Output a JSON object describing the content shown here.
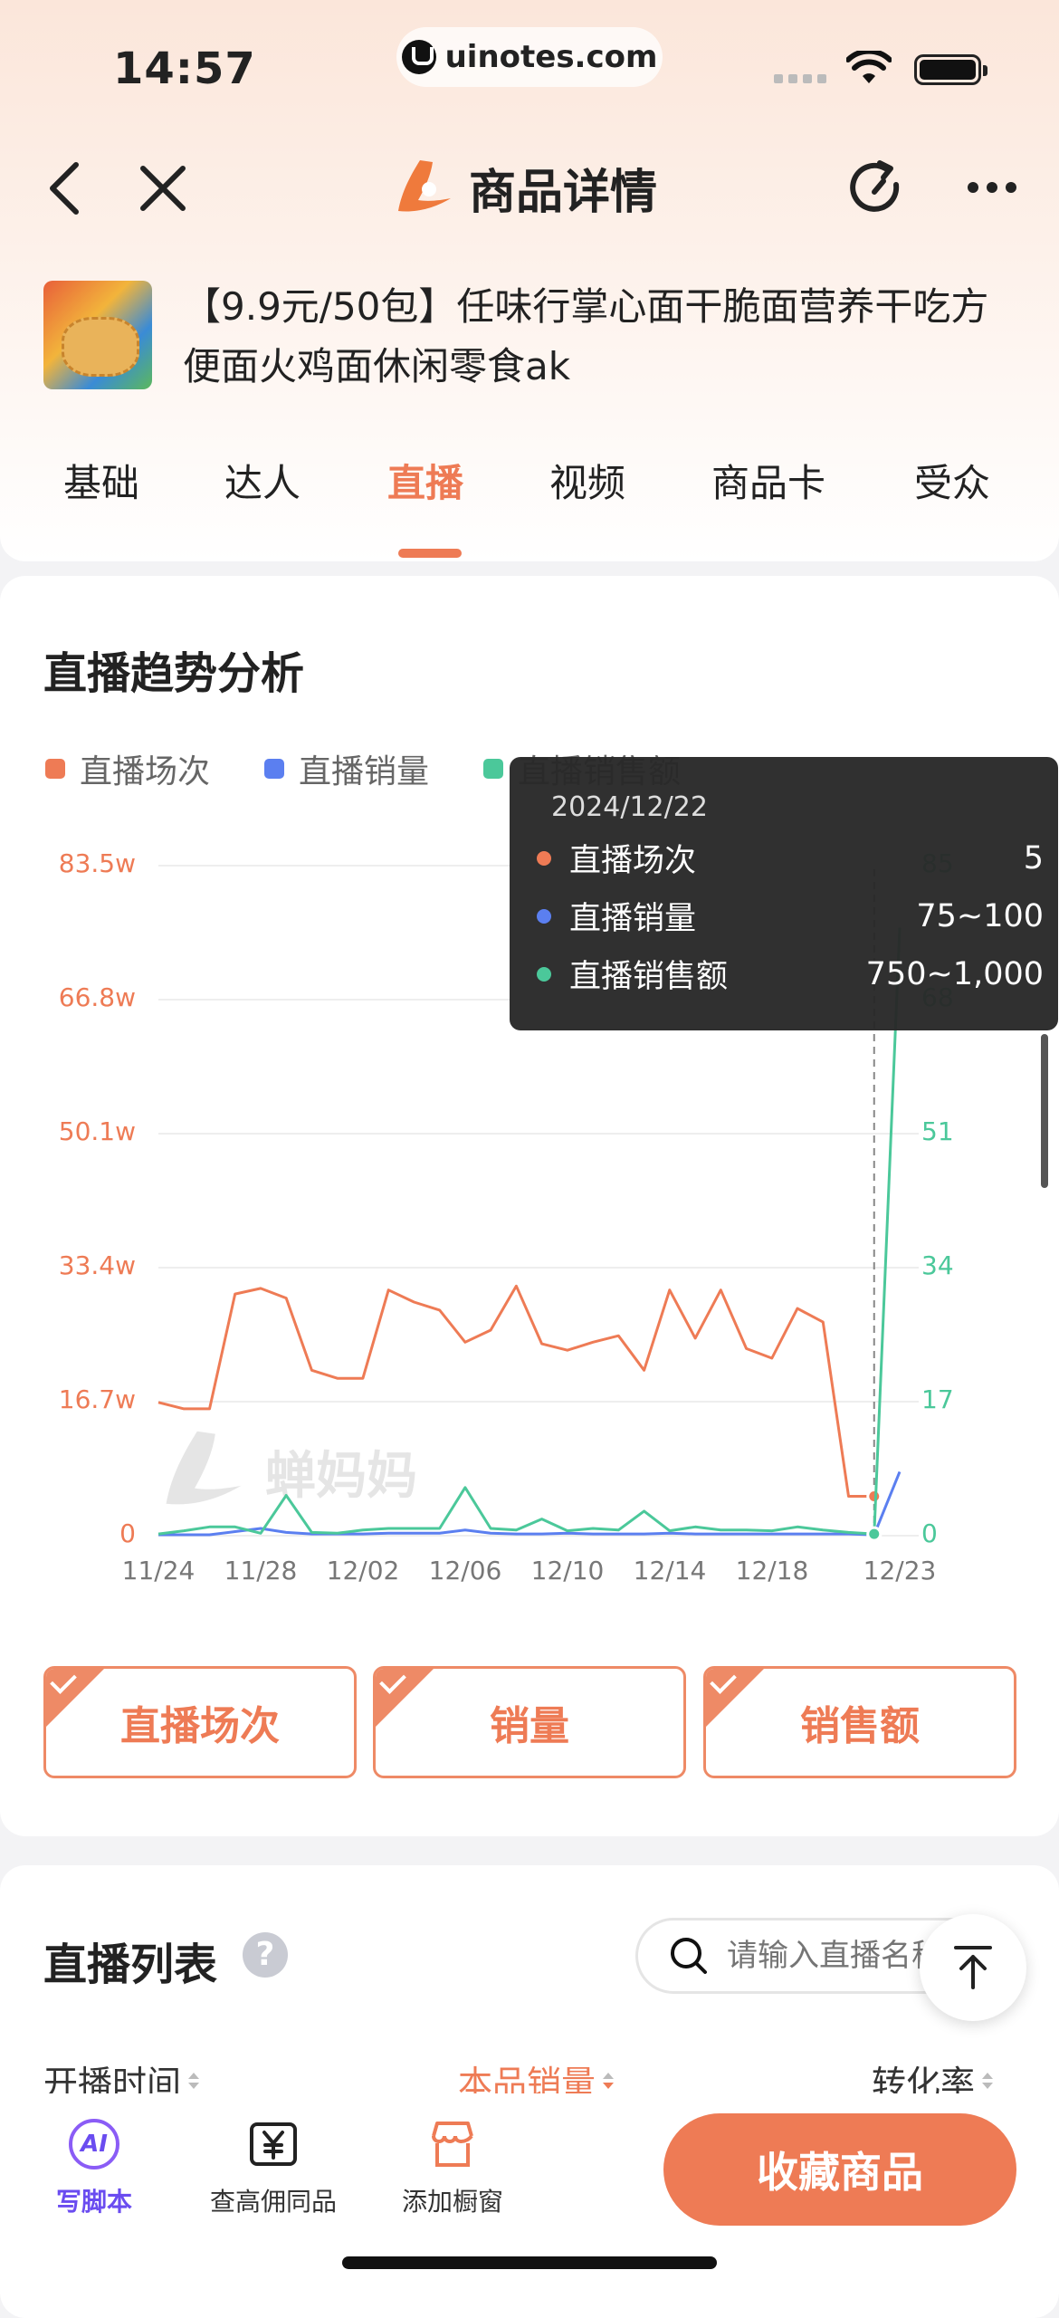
{
  "status": {
    "time": "14:57",
    "url": "uinotes.com"
  },
  "nav": {
    "title": "商品详情"
  },
  "product": {
    "title": "【9.9元/50包】任味行掌心面干脆面营养干吃方便面火鸡面休闲零食ak"
  },
  "tabs": [
    {
      "label": "基础"
    },
    {
      "label": "达人"
    },
    {
      "label": "直播",
      "active": true
    },
    {
      "label": "视频"
    },
    {
      "label": "商品卡"
    },
    {
      "label": "受众"
    }
  ],
  "trend": {
    "title": "直播趋势分析",
    "watermark": "蝉妈妈",
    "toggles": [
      "直播场次",
      "销量",
      "销售额"
    ]
  },
  "chart_data": {
    "type": "line",
    "legend": [
      "直播场次",
      "直播销量",
      "直播销售额"
    ],
    "colors": {
      "场次": "#ee7b55",
      "销量": "#5b7ff0",
      "销售额": "#4bc89a"
    },
    "y_left_ticks": [
      "0",
      "16.7w",
      "33.4w",
      "50.1w",
      "66.8w",
      "83.5w"
    ],
    "y_right_ticks": [
      "0",
      "17",
      "34",
      "51",
      "68",
      "85"
    ],
    "x_ticks": [
      "11/24",
      "11/28",
      "12/02",
      "12/06",
      "12/10",
      "12/14",
      "12/18",
      "12/23"
    ],
    "ylim_left": [
      0,
      835000
    ],
    "ylim_right": [
      0,
      85
    ],
    "x": [
      "11/24",
      "11/25",
      "11/26",
      "11/27",
      "11/28",
      "11/29",
      "11/30",
      "12/01",
      "12/02",
      "12/03",
      "12/04",
      "12/05",
      "12/06",
      "12/07",
      "12/08",
      "12/09",
      "12/10",
      "12/11",
      "12/12",
      "12/13",
      "12/14",
      "12/15",
      "12/16",
      "12/17",
      "12/18",
      "12/19",
      "12/20",
      "12/21",
      "12/22",
      "12/23"
    ],
    "series": [
      {
        "name": "直播场次",
        "axis": "left",
        "values": [
          165000,
          157000,
          157000,
          300000,
          307000,
          295000,
          205000,
          195000,
          195000,
          305000,
          290000,
          280000,
          240000,
          255000,
          310000,
          238000,
          230000,
          240000,
          248000,
          205000,
          305000,
          245000,
          305000,
          232000,
          220000,
          282000,
          265000,
          48000,
          48000,
          null
        ]
      },
      {
        "name": "直播销量",
        "axis": "right",
        "values": [
          0,
          0,
          0,
          0.4,
          0.8,
          0.3,
          0.1,
          0.1,
          0.1,
          0.2,
          0.2,
          0.2,
          0.6,
          0.2,
          0.1,
          0.1,
          0.2,
          0.1,
          0.1,
          0.1,
          0.2,
          0.1,
          0.1,
          0.1,
          0.1,
          0.1,
          0.1,
          0.1,
          0,
          8
        ]
      },
      {
        "name": "直播销售额",
        "axis": "right",
        "values": [
          0.1,
          0.5,
          1,
          1,
          0.2,
          5,
          0.3,
          0.2,
          0.6,
          0.8,
          0.8,
          0.8,
          6,
          0.8,
          0.6,
          2,
          0.5,
          0.8,
          0.6,
          3,
          0.5,
          1,
          0.6,
          0.6,
          0.5,
          1,
          0.6,
          0.3,
          0.1,
          77
        ]
      }
    ],
    "tooltip": {
      "date": "2024/12/22",
      "rows": [
        {
          "name": "直播场次",
          "value": "5"
        },
        {
          "name": "直播销量",
          "value": "75~100"
        },
        {
          "name": "直播销售额",
          "value": "750~1,000"
        }
      ]
    }
  },
  "live_list": {
    "title": "直播列表",
    "search_placeholder": "请输入直播名称",
    "columns": [
      "开播时间",
      "本品销量",
      "转化率"
    ]
  },
  "bottom_bar": {
    "items": [
      "写脚本",
      "查高佣同品",
      "添加橱窗"
    ],
    "ai_badge": "AI",
    "collect_label": "收藏商品"
  }
}
